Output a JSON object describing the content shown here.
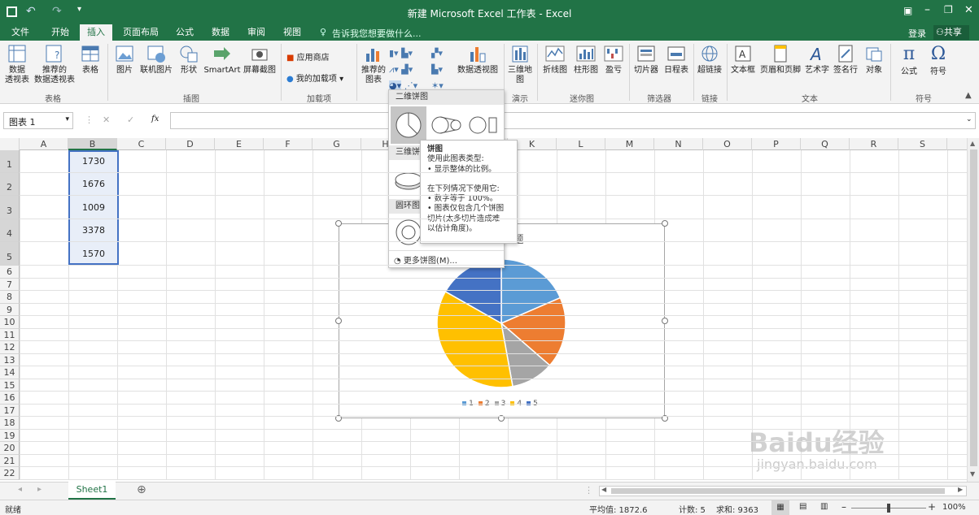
{
  "window": {
    "title": "新建 Microsoft Excel 工作表 - Excel"
  },
  "account": {
    "login": "登录",
    "share": "共享"
  },
  "tabs": [
    "文件",
    "开始",
    "插入",
    "页面布局",
    "公式",
    "数据",
    "审阅",
    "视图"
  ],
  "active_tab": "插入",
  "tell_me": "告诉我您想要做什么...",
  "ribbon": {
    "pivot_table": "数据\n透视表",
    "recommended_pivot": "推荐的\n数据透视表",
    "table": "表格",
    "group_tables": "表格",
    "picture": "图片",
    "online_picture": "联机图片",
    "shapes": "形状",
    "smartart": "SmartArt",
    "screenshot": "屏幕截图",
    "group_illustrations": "插图",
    "app_store": "应用商店",
    "my_addins": "我的加载项",
    "group_addins": "加载项",
    "recommended_charts": "推荐的\n图表",
    "pivot_chart": "数据透视图",
    "map_3d": "三维地\n图",
    "group_tours": "演示",
    "line": "折线图",
    "column": "柱形图",
    "win_loss": "盈亏",
    "group_sparklines": "迷你图",
    "slicer": "切片器",
    "timeline": "日程表",
    "group_filters": "筛选器",
    "hyperlink": "超链接",
    "group_links": "链接",
    "textbox": "文本框",
    "header_footer": "页眉和页脚",
    "wordart": "艺术字",
    "signature": "签名行",
    "object": "对象",
    "group_text": "文本",
    "equation": "公式",
    "symbol": "符号",
    "group_symbols": "符号"
  },
  "formula_bar": {
    "name_box": "图表 1",
    "fx": "fx",
    "cancel": "✕",
    "enter": "✓",
    "value": ""
  },
  "columns": [
    "A",
    "B",
    "C",
    "D",
    "E",
    "F",
    "G",
    "H",
    "I",
    "J",
    "K",
    "L",
    "M",
    "N",
    "O",
    "P",
    "Q",
    "R",
    "S"
  ],
  "rows": [
    "1",
    "2",
    "3",
    "4",
    "5",
    "6",
    "7",
    "8",
    "9",
    "10",
    "11",
    "12",
    "13",
    "14",
    "15",
    "16",
    "17",
    "18",
    "19",
    "20",
    "21",
    "22"
  ],
  "cells_b": [
    "1730",
    "1676",
    "1009",
    "3378",
    "1570"
  ],
  "dropdown": {
    "header_2d": "二维饼图",
    "header_3d": "三维饼",
    "header_donut": "圆环图",
    "more": "更多饼图(M)..."
  },
  "tooltip": {
    "title": "饼图",
    "line1": "使用此图表类型:",
    "line2": "• 显示整体的比例。",
    "line3": "在下列情况下使用它:",
    "line4": "• 数字等于 100%。",
    "line5": "• 图表仅包含几个饼图",
    "line6": "切片(太多切片造成难",
    "line7": "以估计角度)。"
  },
  "chart_data": {
    "type": "pie",
    "title": "图表标题",
    "categories": [
      "1",
      "2",
      "3",
      "4",
      "5"
    ],
    "values": [
      1730,
      1676,
      1009,
      3378,
      1570
    ],
    "colors": [
      "#5b9bd5",
      "#ed7d31",
      "#a5a5a5",
      "#ffc000",
      "#4472c4"
    ],
    "legend": "bottom"
  },
  "sheet": {
    "tab": "Sheet1",
    "add": "⊕"
  },
  "status": {
    "ready": "就绪",
    "average": "平均值: 1872.6",
    "count": "计数: 5",
    "sum": "求和: 9363",
    "zoom": "100%"
  },
  "watermark": {
    "brand": "Baidu经验",
    "url": "jingyan.baidu.com"
  }
}
